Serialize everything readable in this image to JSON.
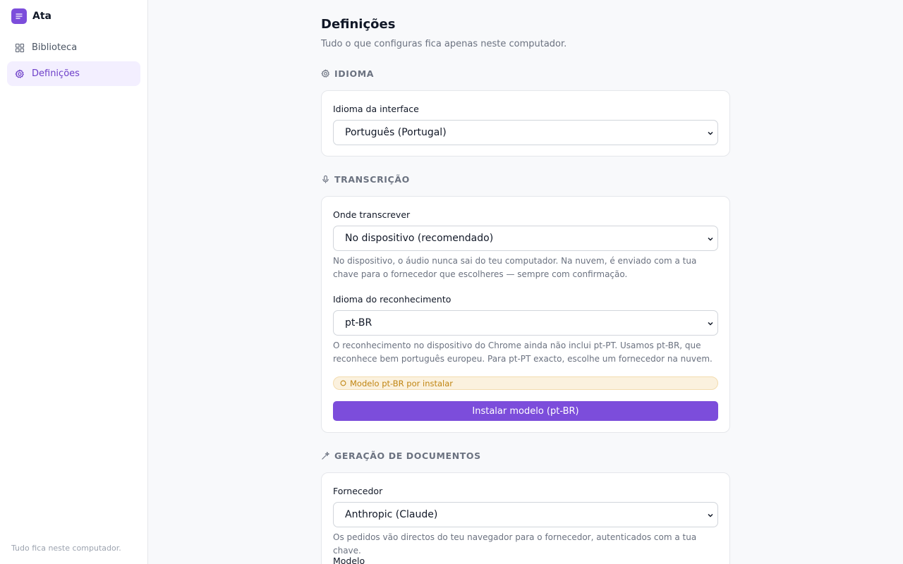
{
  "app": {
    "name": "Ata"
  },
  "sidebar": {
    "items": [
      {
        "label": "Biblioteca",
        "icon": "grid-icon",
        "active": false
      },
      {
        "label": "Definições",
        "icon": "gear-icon",
        "active": true
      }
    ],
    "footer": "Tudo fica neste computador."
  },
  "page": {
    "title": "Definições",
    "subtitle": "Tudo o que configuras fica apenas neste computador."
  },
  "sections": {
    "language": {
      "heading": "IDIOMA",
      "icon": "gear-icon",
      "interface_label": "Idioma da interface",
      "interface_value": "Português (Portugal)"
    },
    "transcription": {
      "heading": "TRANSCRIÇÃO",
      "icon": "microphone-icon",
      "where_label": "Onde transcrever",
      "where_value": "No dispositivo (recomendado)",
      "where_help": "No dispositivo, o áudio nunca sai do teu computador. Na nuvem, é enviado com a tua chave para o fornecedor que escolheres — sempre com confirmação.",
      "recognition_label": "Idioma do reconhecimento",
      "recognition_value": "pt-BR",
      "recognition_help": "O reconhecimento no dispositivo do Chrome ainda não inclui pt-PT. Usamos pt-BR, que reconhece bem português europeu. Para pt-PT exacto, escolhe um fornecedor na nuvem.",
      "status_badge": "Modelo pt-BR por instalar",
      "install_button": "Instalar modelo (pt-BR)"
    },
    "generation": {
      "heading": "GERAÇÃO DE DOCUMENTOS",
      "icon": "sparkle-icon",
      "provider_label": "Fornecedor",
      "provider_value": "Anthropic (Claude)",
      "provider_help": "Os pedidos vão directos do teu navegador para o fornecedor, autenticados com a tua chave.",
      "model_label": "Modelo"
    }
  },
  "colors": {
    "accent": "#7c4ddb",
    "accent_bg": "#f3efff",
    "warning_text": "#c08512",
    "warning_bg": "#fbf1de"
  }
}
